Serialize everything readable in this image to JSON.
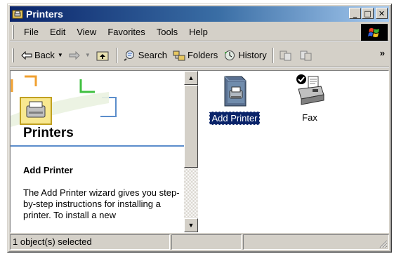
{
  "window": {
    "title": "Printers"
  },
  "menu": [
    "File",
    "Edit",
    "View",
    "Favorites",
    "Tools",
    "Help"
  ],
  "toolbar": {
    "back_label": "Back",
    "search_label": "Search",
    "folders_label": "Folders",
    "history_label": "History",
    "more": "»"
  },
  "left_pane": {
    "heading": "Printers",
    "info_title": "Add Printer",
    "info_text": "The Add Printer wizard gives you step-by-step instructions for installing a printer. To install a new"
  },
  "items": [
    {
      "label": "Add Printer",
      "selected": true,
      "icon": "add-printer-icon"
    },
    {
      "label": "Fax",
      "selected": false,
      "icon": "fax-printer-icon"
    }
  ],
  "status": {
    "text": "1 object(s) selected"
  },
  "colors": {
    "titlebar": "#0a246a",
    "selection": "#0a246a",
    "face": "#d4d0c8",
    "accent_rule": "#5b8dcb"
  }
}
